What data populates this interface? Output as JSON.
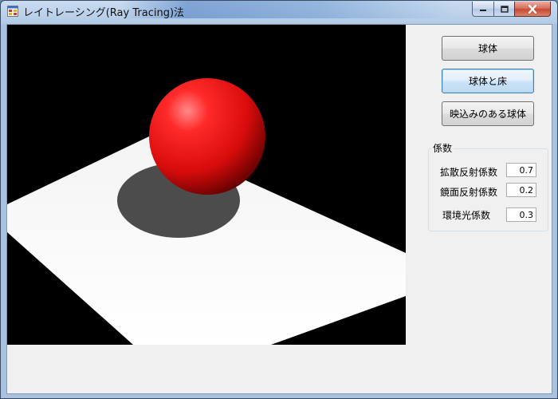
{
  "window": {
    "title": "レイトレーシング(Ray Tracing)法"
  },
  "controls": {
    "minimize_icon": "minimize-icon",
    "maximize_icon": "maximize-icon",
    "close_icon": "close-icon"
  },
  "buttons": {
    "sphere": "球体",
    "sphere_and_floor": "球体と床",
    "reflective_sphere": "映込みのある球体"
  },
  "coefficients": {
    "group_label": "係数",
    "diffuse_label": "拡散反射係数",
    "diffuse_value": "0.7",
    "specular_label": "鏡面反射係数",
    "specular_value": "0.2",
    "ambient_label": "環境光係数",
    "ambient_value": "0.3"
  },
  "scene": {
    "sphere_color": "#e01010",
    "floor_color": "#ffffff",
    "shadow_color": "#4c4c4c",
    "background_color": "#000000"
  }
}
